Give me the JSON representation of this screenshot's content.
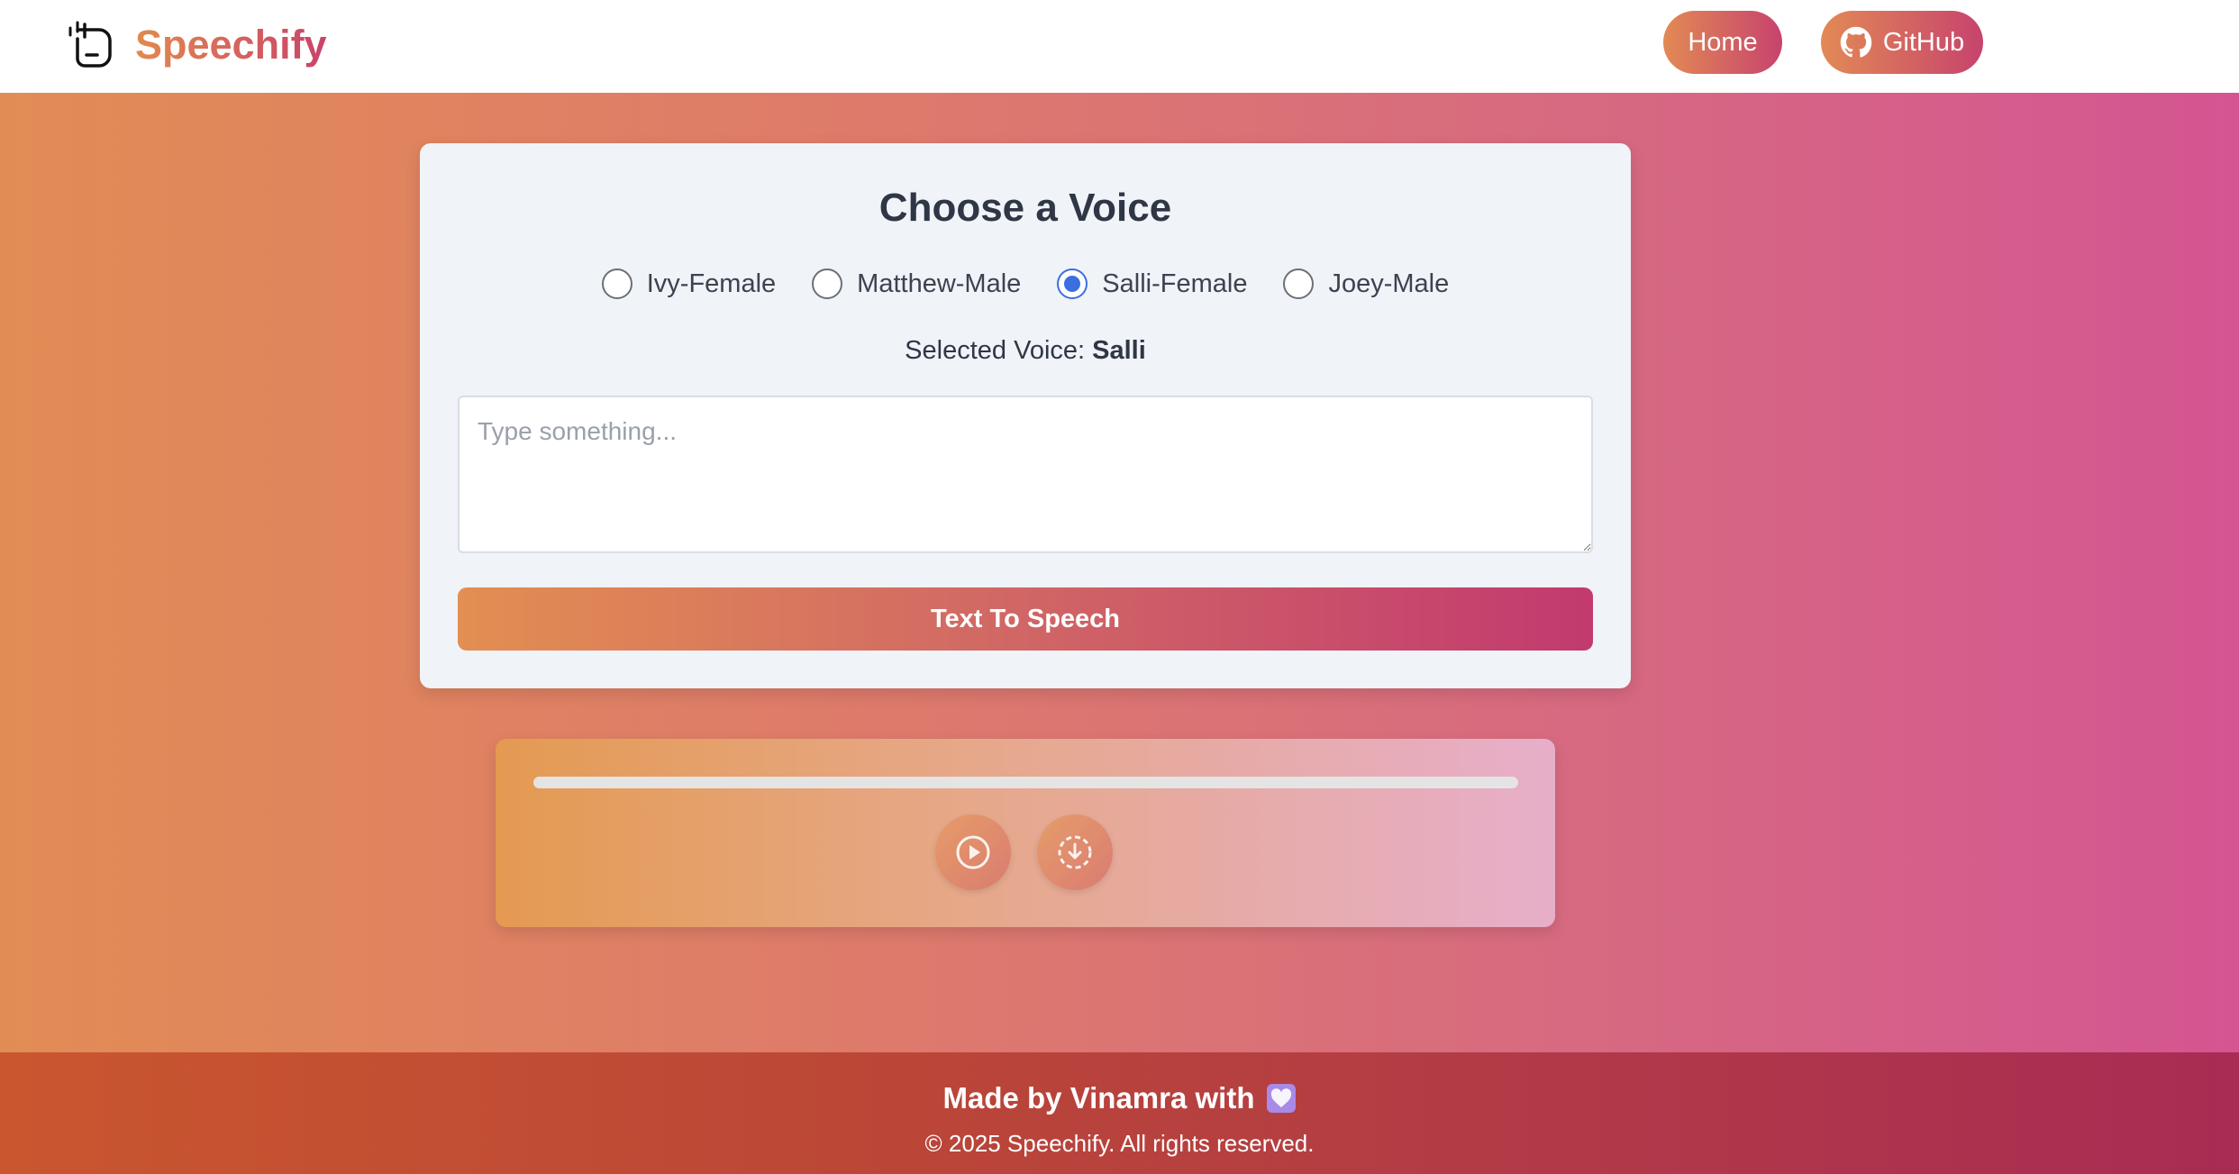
{
  "navbar": {
    "brand": "Speechify",
    "home_label": "Home",
    "github_label": "GitHub"
  },
  "card": {
    "title": "Choose a Voice",
    "voices": [
      {
        "label": "Ivy-Female",
        "checked": false
      },
      {
        "label": "Matthew-Male",
        "checked": false
      },
      {
        "label": "Salli-Female",
        "checked": true
      },
      {
        "label": "Joey-Male",
        "checked": false
      }
    ],
    "selected_prefix": "Selected Voice:",
    "selected_value": "Salli",
    "input": {
      "value": "",
      "placeholder": "Type something..."
    },
    "button_label": "Text To Speech"
  },
  "player": {
    "progress": 0,
    "play_icon": "play-icon",
    "download_icon": "download-icon"
  },
  "footer": {
    "made_by": "Made by Vinamra with",
    "heart_icon": "purple-heart-icon",
    "copyright": "© 2025 Speechify. All rights reserved."
  },
  "colors": {
    "brand_start": "#e28a4e",
    "brand_end": "#c9426a",
    "radio_selected": "#3b6fe0"
  }
}
